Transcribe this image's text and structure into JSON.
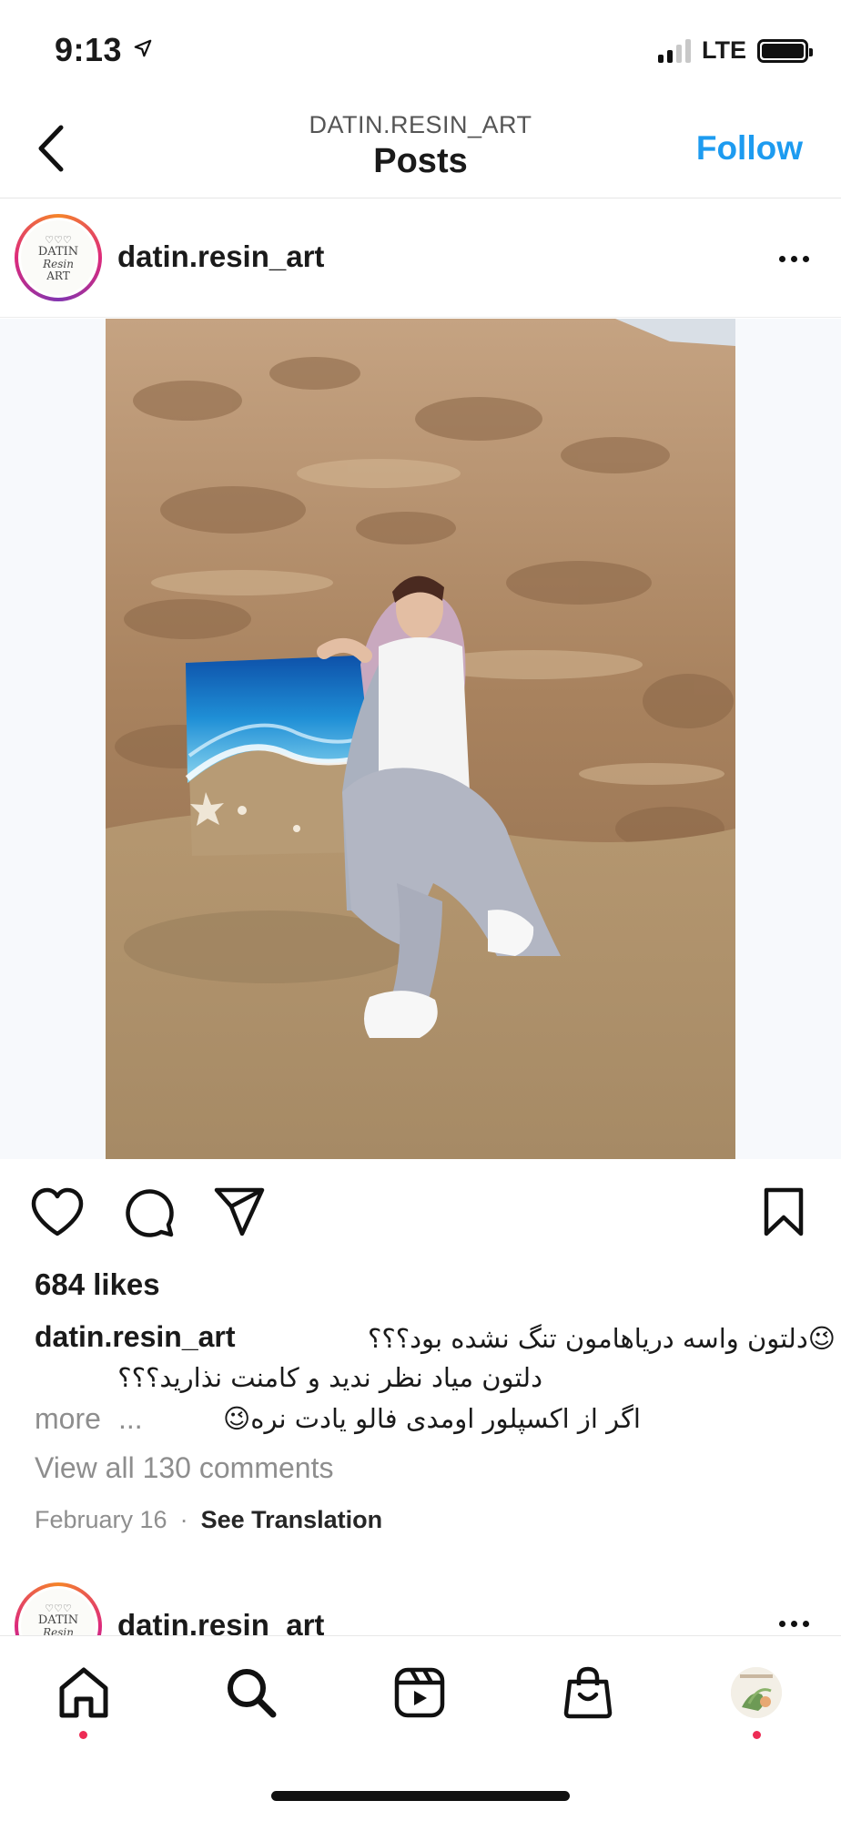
{
  "status_bar": {
    "time": "9:13",
    "network": "LTE",
    "icons": [
      "location-arrow-icon",
      "signal-icon",
      "battery-icon"
    ]
  },
  "header": {
    "account": "DATIN.RESIN_ART",
    "title": "Posts",
    "follow_label": "Follow",
    "back_icon": "chevron-left-icon"
  },
  "post": {
    "username": "datin.resin_art",
    "avatar_logo": {
      "line1": "DATIN",
      "line2": "Resin",
      "line3": "ART",
      "hearts": "♡♡♡"
    },
    "likes": "684 likes",
    "caption": {
      "line1": "😉دلتون واسه دریاهامون تنگ نشده بود؟؟؟",
      "line2": "دلتون میاد نظر ندید و کامنت نذارید؟؟؟",
      "line3": "اگر از اکسپلور اومدی فالو یادت نره😉",
      "ellipsis": "...",
      "more_label": "more"
    },
    "view_comments": "View all 130 comments",
    "date": "February 16",
    "separator": "·",
    "see_translation": "See Translation",
    "action_icons": [
      "heart-icon",
      "comment-icon",
      "share-icon",
      "bookmark-icon"
    ]
  },
  "next_post": {
    "username": "datin.resin_art"
  },
  "tab_bar": {
    "items": [
      "home-icon",
      "search-icon",
      "reels-icon",
      "shop-icon",
      "profile-avatar"
    ]
  },
  "colors": {
    "follow_blue": "#1d9bf0",
    "muted_gray": "#8e8e8e",
    "notification_red": "#ed2c55"
  }
}
